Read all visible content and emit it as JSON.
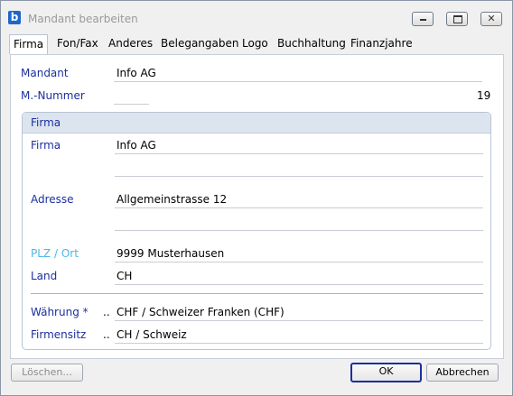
{
  "window": {
    "app_icon": "b",
    "title": "Mandant bearbeiten",
    "controls": {
      "minimize": "minimize-icon",
      "maximize": "maximize-icon",
      "close": "close-icon"
    }
  },
  "tabs": [
    {
      "label": "Firma",
      "active": true
    },
    {
      "label": "Fon/Fax"
    },
    {
      "label": "Anderes"
    },
    {
      "label": "Belegangaben"
    },
    {
      "label": "Logo"
    },
    {
      "label": "Buchhaltung"
    },
    {
      "label": "Finanzjahre"
    }
  ],
  "form": {
    "mandant_label": "Mandant",
    "mandant_value": "Info AG",
    "nummer_label": "M.-Nummer",
    "nummer_value": "19",
    "group_title": "Firma",
    "firma_label": "Firma",
    "firma_value": "Info AG",
    "firma_value2": "",
    "adresse_label": "Adresse",
    "adresse_value": "Allgemeinstrasse 12",
    "adresse_value2": "",
    "plz_label": "PLZ / Ort",
    "plz_value": "9999 Musterhausen",
    "land_label": "Land",
    "land_value": "CH",
    "waehrung_label": "Währung *",
    "waehrung_dots": "..",
    "waehrung_value": "CHF / Schweizer Franken (CHF)",
    "firmensitz_label": "Firmensitz",
    "firmensitz_dots": "..",
    "firmensitz_value": "CH / Schweiz"
  },
  "buttons": {
    "delete": "Löschen...",
    "ok": "OK",
    "cancel": "Abbrechen"
  }
}
